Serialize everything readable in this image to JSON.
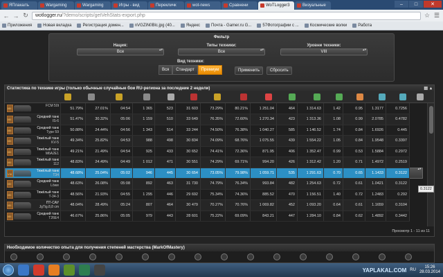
{
  "browser": {
    "tabs": [
      {
        "label": "ЯПлакалъ",
        "active": false
      },
      {
        "label": "Wargaming",
        "active": false
      },
      {
        "label": "Wargaming",
        "active": false
      },
      {
        "label": "Игры - вид",
        "active": false
      },
      {
        "label": "Перекличк",
        "active": false
      },
      {
        "label": "wot-news",
        "active": false
      },
      {
        "label": "Сравнени",
        "active": false
      },
      {
        "label": "WoTLogger3",
        "active": true
      },
      {
        "label": "Визуальные",
        "active": false
      }
    ],
    "url_host": "wotlogger.ru",
    "url_path": "/?demo/scripts/getVehStats-export.php",
    "bookmarks": [
      "Приложения",
      "Новая вкладка",
      "Регистрация домен...",
      "nVGZiN0Blc.jpg (40...",
      "Яндекс",
      "Почта - Gamer.ru G...",
      "57Фотографии с ...",
      "Космические волки",
      "Работа"
    ]
  },
  "filter": {
    "title": "Фильтр",
    "nation_label": "Нация:",
    "nation_value": "Все",
    "type_label": "Типы техники:",
    "type_value": "Все",
    "level_label": "Уровни техники:",
    "level_value": "VIII",
    "vid_label": "Вид техники:",
    "vid_options": [
      "Вся",
      "Стандарт",
      "Премиум"
    ],
    "vid_selected": "Премиум",
    "apply_label": "Применить",
    "reset_label": "Сбросить"
  },
  "stats": {
    "title": "Статистика по технике игры (только обычные случайные бои RU-региона за последние 2 недели)",
    "rows": [
      {
        "tier": "VIII",
        "type": "",
        "name": "FCM 50t",
        "cells": [
          "51.79%",
          "27.01%",
          "04:54",
          "1 365",
          "523",
          "31 603",
          "73.29%",
          "80.21%",
          "1 251.04",
          "464",
          "1 314.63",
          "1.42",
          "0.95",
          "1.3177",
          "0.7256"
        ]
      },
      {
        "tier": "VIII",
        "type": "Средний танк",
        "name": "IS-6",
        "cells": [
          "51.47%",
          "30.32%",
          "05:06",
          "1 159",
          "510",
          "33 649",
          "76.35%",
          "72.60%",
          "1 270.34",
          "423",
          "1 313.36",
          "1.08",
          "0.99",
          "2.0785",
          "0.4782"
        ]
      },
      {
        "tier": "VIII",
        "type": "Средний танк",
        "name": "Type 59",
        "cells": [
          "50.88%",
          "24.44%",
          "04:56",
          "1 343",
          "514",
          "33 244",
          "74.50%",
          "76.38%",
          "1 040.27",
          "585",
          "1 146.52",
          "1.74",
          "0.84",
          "1.6926",
          "0.445"
        ]
      },
      {
        "tier": "VIII",
        "type": "Тяжёлый танк",
        "name": "KV-5",
        "cells": [
          "49.34%",
          "25.82%",
          "04:53",
          "988",
          "498",
          "30 834",
          "74.09%",
          "68.76%",
          "1 075.55",
          "439",
          "1 554.22",
          "1.05",
          "0.84",
          "1.9548",
          "0.3397"
        ]
      },
      {
        "tier": "VIII",
        "type": "Тяжёлый танк",
        "name": "M6A2E1",
        "cells": [
          "49.21%",
          "21.49%",
          "04:54",
          "925",
          "433",
          "30 652",
          "74.41%",
          "72.36%",
          "871.95",
          "406",
          "1 352.47",
          "0.99",
          "0.53",
          "1.5884",
          "0.2972"
        ]
      },
      {
        "tier": "VIII",
        "type": "Тяжёлый танк",
        "name": "112",
        "cells": [
          "48.83%",
          "24.49%",
          "04:49",
          "1 012",
          "471",
          "30 551",
          "74.29%",
          "69.71%",
          "994.20",
          "426",
          "1 312.42",
          "1.20",
          "0.71",
          "1.4972",
          "0.2519"
        ]
      },
      {
        "tier": "VIII",
        "type": "Тяжёлый танк",
        "name": "T34",
        "cells": [
          "48.68%",
          "25.04%",
          "05:02",
          "946",
          "445",
          "30 654",
          "73.05%",
          "79.98%",
          "1 059.71",
          "535",
          "1 291.63",
          "0.70",
          "0.65",
          "1.1433",
          "0.3122"
        ]
      },
      {
        "tier": "VIII",
        "type": "Средний танк",
        "name": "Löwe",
        "cells": [
          "48.63%",
          "26.08%",
          "05:08",
          "892",
          "463",
          "31 730",
          "74.79%",
          "76.34%",
          "993.84",
          "482",
          "1 254.63",
          "0.72",
          "0.61",
          "1.0421",
          "0.3122"
        ]
      },
      {
        "tier": "VIII",
        "type": "Тяжёлый танк",
        "name": "T-34-3",
        "cells": [
          "48.56%",
          "21.93%",
          "04:55",
          "1 295",
          "446",
          "29 692",
          "75.34%",
          "74.36%",
          "885.52",
          "470",
          "1 156.51",
          "1.40",
          "0.72",
          "1.2483",
          "0.292"
        ]
      },
      {
        "tier": "VIII",
        "type": "ПТ-САУ",
        "name": "JgTig.8,8 cm",
        "cells": [
          "48.04%",
          "28.49%",
          "05:24",
          "807",
          "464",
          "30 479",
          "70.27%",
          "70.76%",
          "1 069.82",
          "452",
          "1 093.20",
          "0.64",
          "0.61",
          "1.1659",
          "0.3104"
        ]
      },
      {
        "tier": "VIII",
        "type": "Средний танк",
        "name": "T26E4",
        "cells": [
          "46.67%",
          "25.86%",
          "05:05",
          "979",
          "443",
          "28 601",
          "75.22%",
          "69.09%",
          "843.21",
          "447",
          "1 284.10",
          "0.84",
          "0.62",
          "1.4892",
          "0.3442"
        ]
      }
    ],
    "selected_row": 6,
    "tooltip": "0.3122",
    "pager": "Просмотр 1 - 11 из 11"
  },
  "mastery": {
    "title": "Необходимое количество опыта для получения степеней мастерства (MarkOfMastery)"
  },
  "taskbar": {
    "lang": "RU",
    "time": "15:26",
    "date": "28.03.2014"
  },
  "watermark": "YAPLAKAL.COM",
  "colors": {
    "accent": "#f39a12",
    "selected_row": "#2c8fc4",
    "tab_bar": "#2a4a72"
  }
}
